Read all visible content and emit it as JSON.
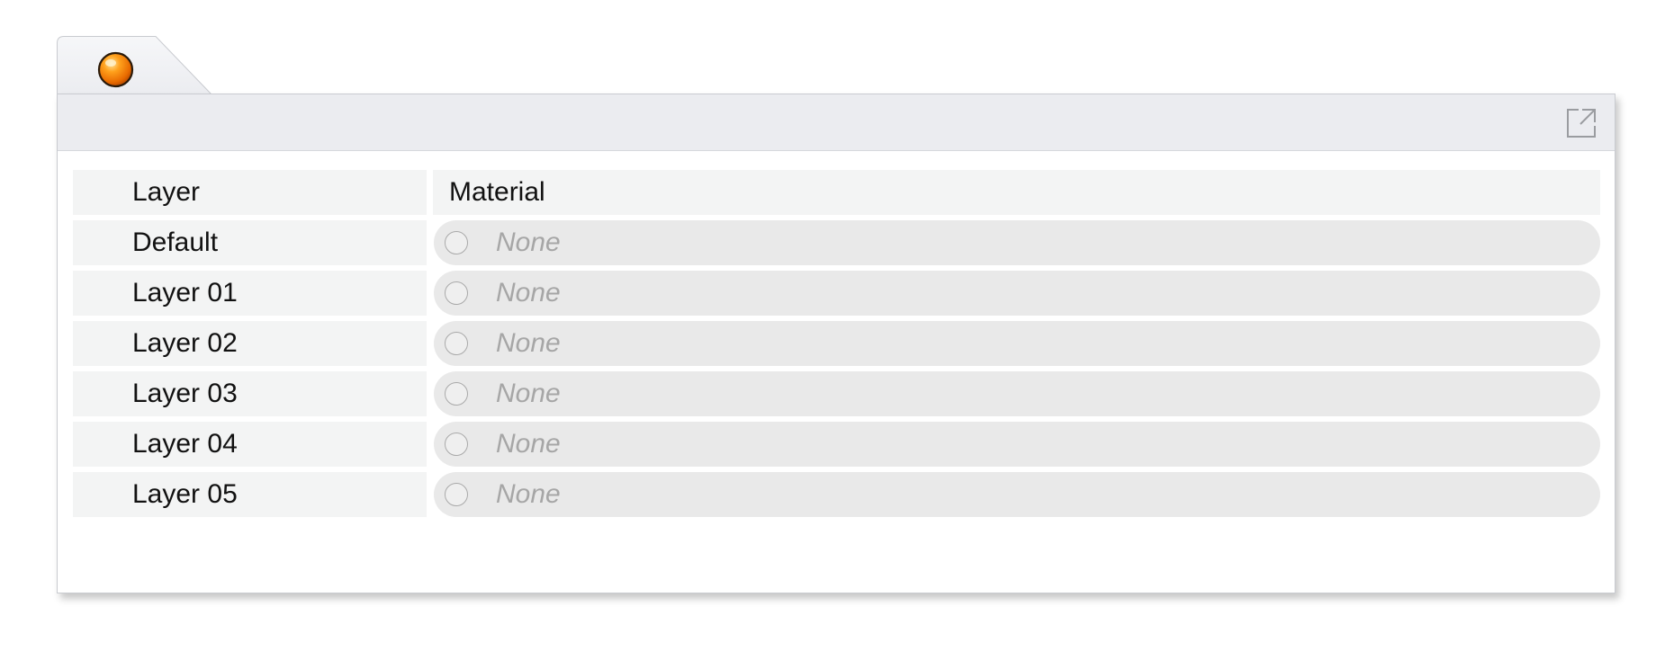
{
  "panel": {
    "tab_icon": "materials-sphere-icon",
    "popout_icon": "popout-icon",
    "accent_color": "#f07d0a"
  },
  "table": {
    "headers": {
      "layer": "Layer",
      "material": "Material"
    },
    "rows": [
      {
        "layer": "Default",
        "material": "None"
      },
      {
        "layer": "Layer 01",
        "material": "None"
      },
      {
        "layer": "Layer 02",
        "material": "None"
      },
      {
        "layer": "Layer 03",
        "material": "None"
      },
      {
        "layer": "Layer 04",
        "material": "None"
      },
      {
        "layer": "Layer 05",
        "material": "None"
      }
    ]
  }
}
